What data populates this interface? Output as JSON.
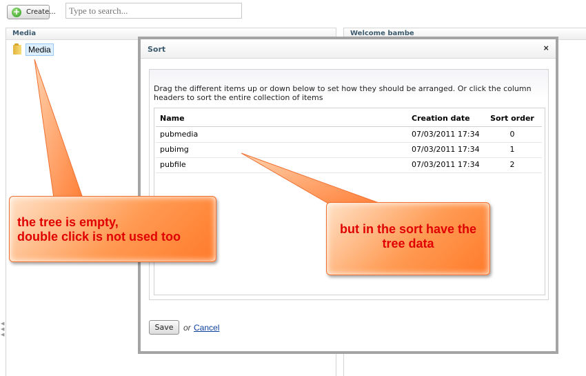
{
  "toolbar": {
    "create_label": "Create...",
    "search_placeholder": "Type to search..."
  },
  "left_panel": {
    "title": "Media",
    "tree_root_label": "Media"
  },
  "right_panel": {
    "title": "Welcome bambe"
  },
  "sort_dialog": {
    "title": "Sort",
    "close_glyph": "×",
    "instructions": "Drag the different items up or down below to set how they should be arranged. Or click the column headers to sort the entire collection of items",
    "columns": [
      "Name",
      "Creation date",
      "Sort order"
    ],
    "rows": [
      {
        "name": "pubmedia",
        "date": "07/03/2011 17:34",
        "order": "0"
      },
      {
        "name": "pubimg",
        "date": "07/03/2011 17:34",
        "order": "1"
      },
      {
        "name": "pubfile",
        "date": "07/03/2011 17:34",
        "order": "2"
      }
    ],
    "save_label": "Save",
    "or_text": "or",
    "cancel_label": "Cancel"
  },
  "annotations": {
    "left_callout": [
      "the tree is empty,",
      "double click is not used too"
    ],
    "right_callout": [
      "but in the sort have the",
      "tree data"
    ]
  },
  "colors": {
    "callout_fill": "#ff8a3d",
    "callout_text": "#e00000",
    "header_text": "#3c5a6e",
    "link": "#0a3e9c"
  },
  "icons": {
    "create": "plus-circle-icon",
    "tree_node": "folder-icon",
    "close": "close-icon"
  }
}
